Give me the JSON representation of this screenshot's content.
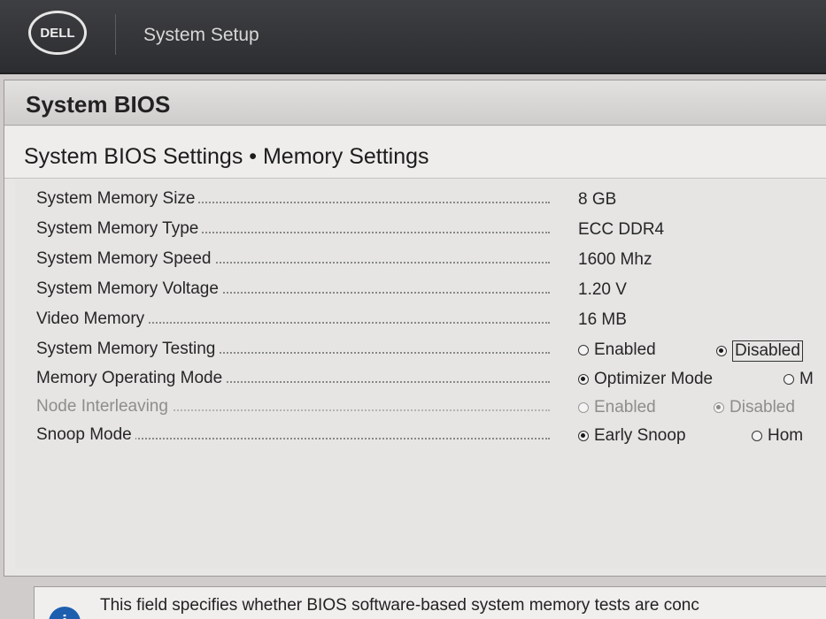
{
  "header": {
    "logo_text": "DELL",
    "title": "System Setup"
  },
  "section": {
    "title": "System BIOS"
  },
  "page": {
    "breadcrumb": "System BIOS Settings • Memory Settings"
  },
  "rows": [
    {
      "label": "System Memory Size",
      "value": "8 GB"
    },
    {
      "label": "System Memory Type",
      "value": "ECC DDR4"
    },
    {
      "label": "System Memory Speed",
      "value": "1600 Mhz"
    },
    {
      "label": "System Memory Voltage",
      "value": "1.20 V"
    },
    {
      "label": "Video Memory",
      "value": "16 MB"
    },
    {
      "label": "System Memory Testing",
      "options": [
        "Enabled",
        "Disabled"
      ],
      "selected": "Disabled"
    },
    {
      "label": "Memory Operating Mode",
      "options": [
        "Optimizer Mode",
        "M"
      ],
      "selected": "Optimizer Mode"
    },
    {
      "label": "Node Interleaving",
      "options": [
        "Enabled",
        "Disabled"
      ],
      "selected": "Disabled",
      "disabled": true
    },
    {
      "label": "Snoop Mode",
      "options": [
        "Early Snoop",
        "Hom"
      ],
      "selected": "Early Snoop"
    }
  ],
  "help": {
    "icon": "info-icon",
    "icon_glyph": "i",
    "text": "This field specifies whether BIOS software-based system memory tests are conc"
  }
}
